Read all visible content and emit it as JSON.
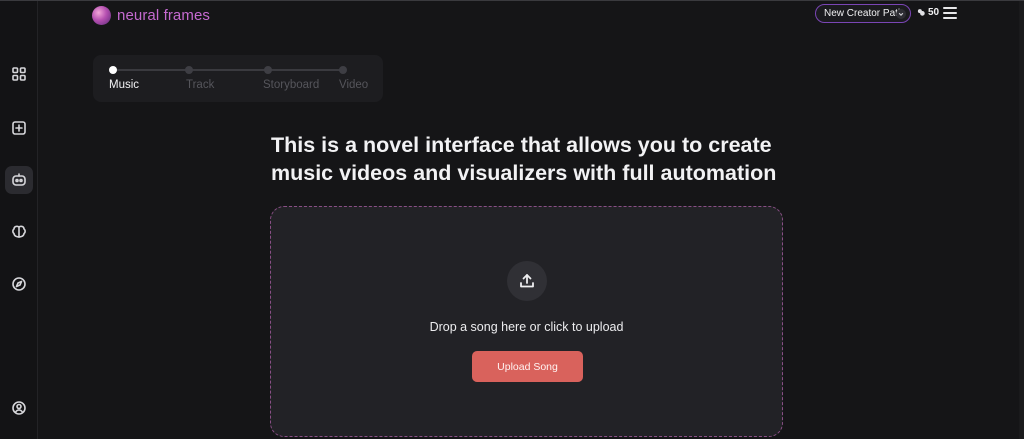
{
  "brand": {
    "name": "neural frames",
    "accent": "#c56ad0"
  },
  "header": {
    "creator_path_label": "New Creator Path",
    "credits_value": "50",
    "credits_icon": "lightning-icon",
    "menu_icon": "hamburger-icon"
  },
  "sidebar": {
    "items": [
      {
        "icon": "grid-icon",
        "active": false
      },
      {
        "icon": "plus-square-icon",
        "active": false
      },
      {
        "icon": "robot-icon",
        "active": true
      },
      {
        "icon": "brain-icon",
        "active": false
      },
      {
        "icon": "compass-icon",
        "active": false
      },
      {
        "icon": "user-circle-icon",
        "active": false
      }
    ]
  },
  "stepper": {
    "steps": [
      {
        "label": "Music",
        "active": true
      },
      {
        "label": "Track",
        "active": false
      },
      {
        "label": "Storyboard",
        "active": false
      },
      {
        "label": "Video",
        "active": false
      }
    ]
  },
  "main": {
    "headline": "This is a novel interface that allows you to create music videos and visualizers with full automation",
    "dropzone_text": "Drop a song here or click to upload",
    "upload_button_label": "Upload Song",
    "upload_icon": "upload-icon",
    "button_color": "#d9625c"
  }
}
